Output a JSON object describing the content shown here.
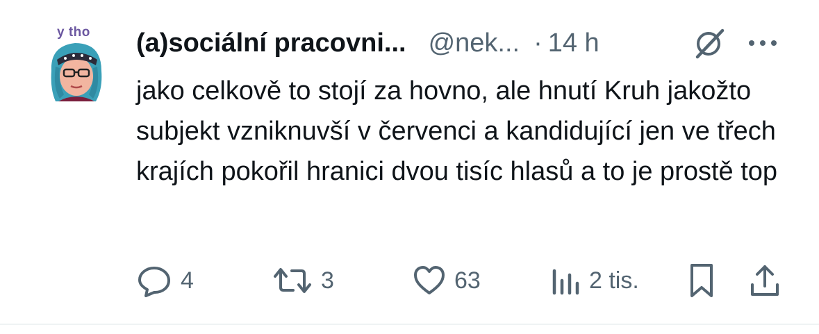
{
  "post": {
    "avatar_label": "y tho",
    "author_name": "(a)sociální pracovni...",
    "author_handle": "@nek...",
    "separator": "·",
    "time": "14 h",
    "text": "jako celkově to stojí za hovno, ale hnutí Kruh jakožto subjekt vzniknuvší v červenci a kandidující jen ve třech krajích pokořil hranici dvou tisíc hlasů a to je prostě top"
  },
  "actions": {
    "replies": "4",
    "reposts": "3",
    "likes": "63",
    "views": "2 tis."
  },
  "icons": [
    "avatar",
    "grok-icon",
    "more-icon",
    "reply-icon",
    "repost-icon",
    "like-icon",
    "views-icon",
    "bookmark-icon",
    "share-icon"
  ],
  "colors": {
    "text": "#0f1419",
    "secondary": "#536471",
    "divider": "#eff3f4"
  }
}
